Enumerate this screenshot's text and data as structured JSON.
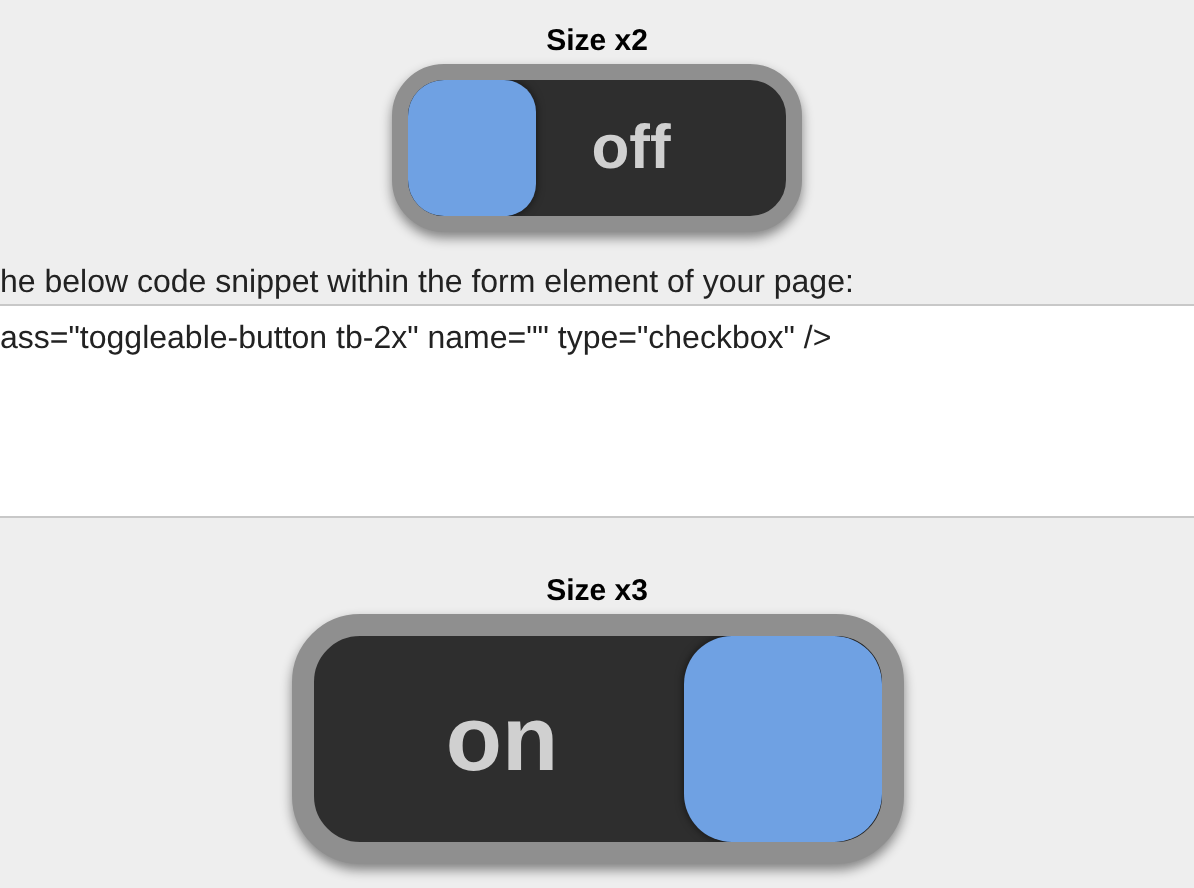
{
  "sections": [
    {
      "title": "Size x2",
      "large": false,
      "toggle": {
        "label": "off",
        "checked": false
      },
      "instruction": "he below code snippet within the form element of your page:",
      "code": "ass=\"toggleable-button tb-2x\" name=\"\" type=\"checkbox\" />"
    },
    {
      "title": "Size x3",
      "large": true,
      "toggle": {
        "label": "on",
        "checked": true
      }
    }
  ]
}
